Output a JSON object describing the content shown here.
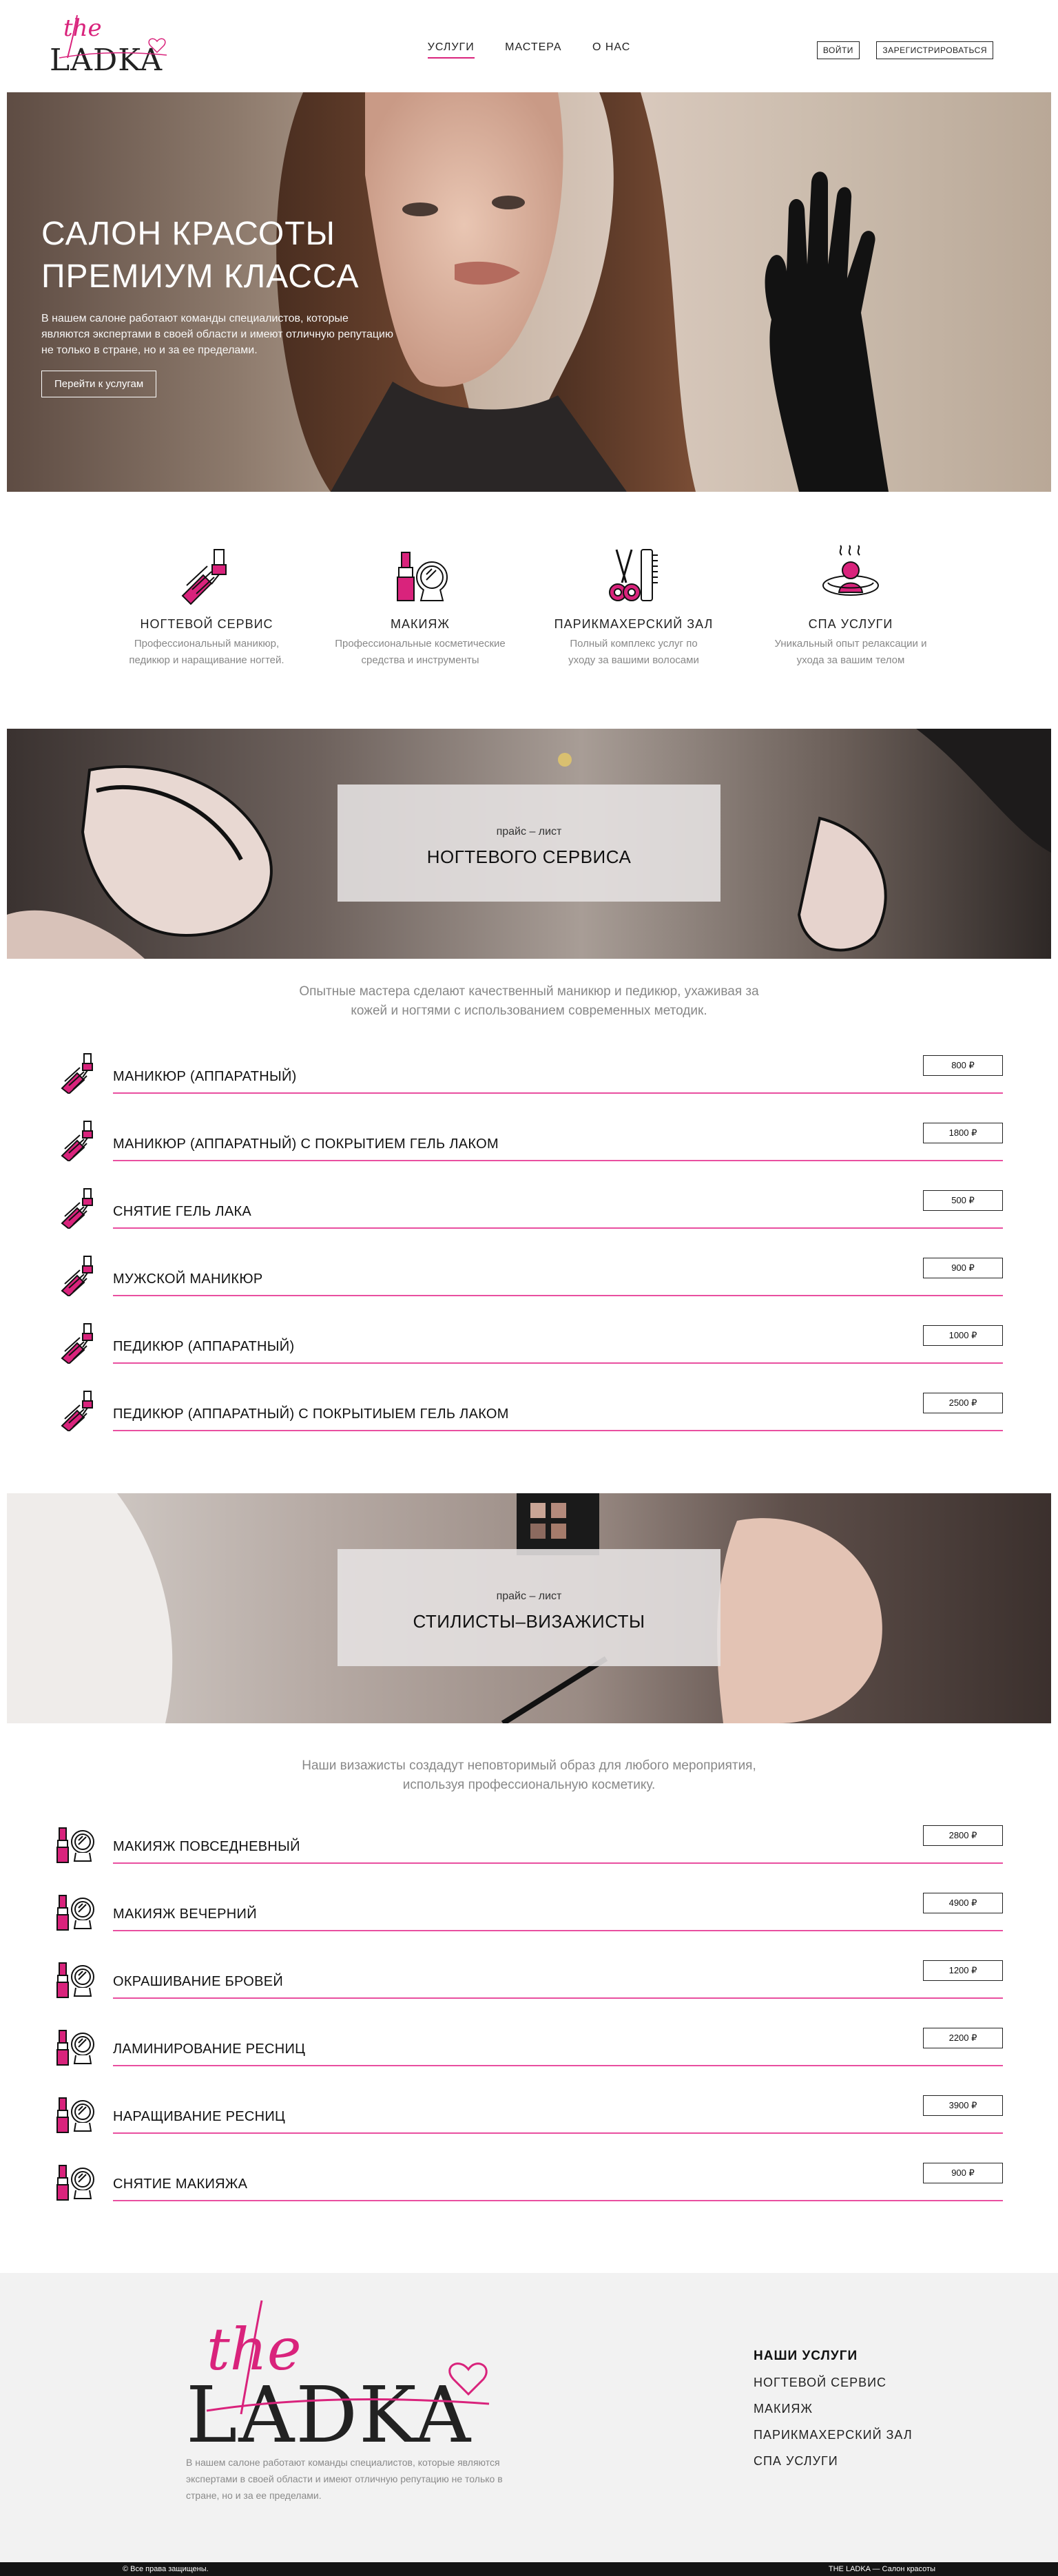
{
  "header": {
    "logo_script": "the",
    "logo_word": "LADKA",
    "nav": [
      {
        "label": "УСЛУГИ",
        "active": true
      },
      {
        "label": "МАСТЕРА",
        "active": false
      },
      {
        "label": "О НАС",
        "active": false
      }
    ],
    "login_label": "ВОЙТИ",
    "register_label": "ЗАРЕГИСТРИРОВАТЬСЯ"
  },
  "hero": {
    "title_line1": "САЛОН КРАСОТЫ",
    "title_line2": "ПРЕМИУМ КЛАССА",
    "description": "В нашем салоне работают команды специалистов, которые являются экспертами в своей области и имеют отличную репутацию не только в стране, но и за ее пределами.",
    "button_label": "Перейти к услугам"
  },
  "services": [
    {
      "icon": "nail-polish-hand-icon",
      "title": "НОГТЕВОЙ СЕРВИС",
      "desc_line1": "Профессиональный маникюр,",
      "desc_line2": "педикюр и наращивание ногтей."
    },
    {
      "icon": "lipstick-mirror-icon",
      "title": "МАКИЯЖ",
      "desc_line1": "Профессиональные косметические",
      "desc_line2": "средства и инструменты"
    },
    {
      "icon": "scissors-comb-icon",
      "title": "ПАРИКМАХЕРСКИЙ ЗАЛ",
      "desc_line1": "Полный комплекс услуг по",
      "desc_line2": "уходу за вашими волосами"
    },
    {
      "icon": "spa-person-icon",
      "title": "СПА УСЛУГИ",
      "desc_line1": "Уникальный опыт релаксации и",
      "desc_line2": "ухода за вашим телом"
    }
  ],
  "nails": {
    "banner_sub": "прайс – лист",
    "banner_title": "НОГТЕВОГО СЕРВИСА",
    "intro_line1": "Опытные мастера сделают качественный маникюр и педикюр, ухаживая за",
    "intro_line2": "кожей и ногтями с использованием современных методик.",
    "items": [
      {
        "name": "МАНИКЮР (АППАРАТНЫЙ)",
        "price": "800 ₽"
      },
      {
        "name": "МАНИКЮР (АППАРАТНЫЙ) С ПОКРЫТИЕМ ГЕЛЬ ЛАКОМ",
        "price": "1800 ₽"
      },
      {
        "name": "СНЯТИЕ ГЕЛЬ ЛАКА",
        "price": "500 ₽"
      },
      {
        "name": "МУЖСКОЙ МАНИКЮР",
        "price": "900 ₽"
      },
      {
        "name": "ПЕДИКЮР (АППАРАТНЫЙ)",
        "price": "1000 ₽"
      },
      {
        "name": "ПЕДИКЮР (АППАРАТНЫЙ) С ПОКРЫТИЫЕМ ГЕЛЬ ЛАКОМ",
        "price": "2500 ₽"
      }
    ]
  },
  "makeup": {
    "banner_sub": "прайс – лист",
    "banner_title": "СТИЛИСТЫ–ВИЗАЖИСТЫ",
    "intro_line1": "Наши визажисты создадут неповторимый образ для любого мероприятия,",
    "intro_line2": "используя профессиональную косметику.",
    "items": [
      {
        "name": "МАКИЯЖ ПОВСЕДНЕВНЫЙ",
        "price": "2800 ₽"
      },
      {
        "name": "МАКИЯЖ ВЕЧЕРНИЙ",
        "price": "4900 ₽"
      },
      {
        "name": "ОКРАШИВАНИЕ БРОВЕЙ",
        "price": "1200 ₽"
      },
      {
        "name": "ЛАМИНИРОВАНИЕ РЕСНИЦ",
        "price": "2200 ₽"
      },
      {
        "name": "НАРАЩИВАНИЕ РЕСНИЦ",
        "price": "3900 ₽"
      },
      {
        "name": "СНЯТИЕ МАКИЯЖА",
        "price": "900 ₽"
      }
    ]
  },
  "footer": {
    "logo_script": "the",
    "logo_word": "LADKA",
    "description": "В нашем салоне работают команды специалистов, которые являются экспертами в своей области и имеют отличную репутацию не только в стране, но и за ее пределами.",
    "nav_title": "НАШИ УСЛУГИ",
    "nav_items": [
      "НОГТЕВОЙ СЕРВИС",
      "МАКИЯЖ",
      "ПАРИКМАХЕРСКИЙ ЗАЛ",
      "СПА УСЛУГИ"
    ],
    "copyright": "© Все права защищены.",
    "brand_line": "THE LADKA — Салон красоты"
  },
  "colors": {
    "accent": "#d9237c",
    "line": "#e94fa0",
    "footer_bg": "#f2f2f2",
    "bottom_bar": "#141414"
  }
}
